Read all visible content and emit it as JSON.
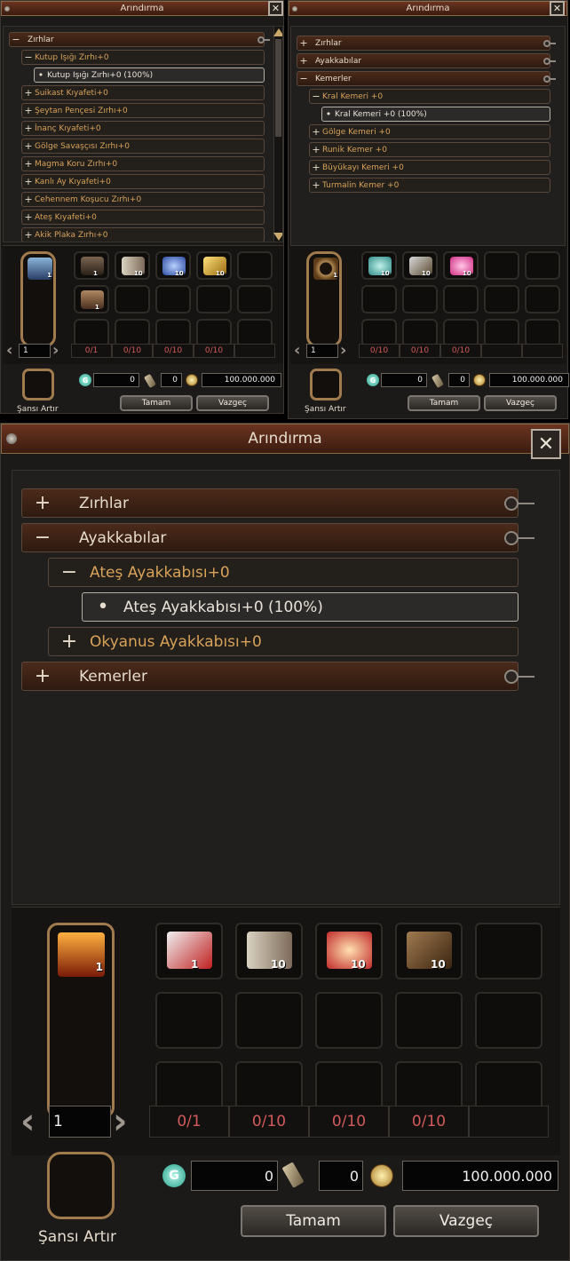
{
  "title": "Arındırma",
  "close_icon": "close-x-icon",
  "panels": {
    "top_left": {
      "tree": [
        {
          "kind": "cat",
          "sign": "−",
          "label": "Zırhlar"
        },
        {
          "kind": "sub",
          "sign": "−",
          "label": "Kutup Işığı Zırhı+0"
        },
        {
          "kind": "leaf",
          "sign": "•",
          "label": "Kutup Işığı Zırhı+0 (100%)"
        },
        {
          "kind": "sub",
          "sign": "+",
          "label": "Suikast Kıyafeti+0"
        },
        {
          "kind": "sub",
          "sign": "+",
          "label": "Şeytan Pençesi Zırhı+0"
        },
        {
          "kind": "sub",
          "sign": "+",
          "label": "İnanç Kıyafeti+0"
        },
        {
          "kind": "sub",
          "sign": "+",
          "label": "Gölge Savaşçısı Zırhı+0"
        },
        {
          "kind": "sub",
          "sign": "+",
          "label": "Magma Koru Zırhı+0"
        },
        {
          "kind": "sub",
          "sign": "+",
          "label": "Kanlı Ay Kıyafeti+0"
        },
        {
          "kind": "sub",
          "sign": "+",
          "label": "Cehennem Koşucu Zırhı+0"
        },
        {
          "kind": "sub",
          "sign": "+",
          "label": "Ateş Kıyafeti+0"
        },
        {
          "kind": "sub",
          "sign": "+",
          "label": "Akik Plaka Zırhı+0"
        }
      ],
      "main_item": {
        "icon": "blue-armor-icon",
        "qty": "1"
      },
      "materials": [
        {
          "icon": "dark-armor-icon",
          "qty": "1"
        },
        {
          "icon": "book-icon",
          "qty": "10"
        },
        {
          "icon": "blue-potion-icon",
          "qty": "10"
        },
        {
          "icon": "gold-bar-icon",
          "qty": "10"
        },
        {
          "icon": "",
          "qty": ""
        }
      ],
      "extra_item": {
        "icon": "helmet-icon",
        "qty": "1"
      },
      "counts": [
        "0/1",
        "0/10",
        "0/10",
        "0/10",
        ""
      ],
      "page": "1",
      "gem_value": "0",
      "scroll_value": "0",
      "cost": "100.000.000",
      "ok_label": "Tamam",
      "cancel_label": "Vazgeç",
      "chance_label": "Şansı Artır"
    },
    "top_right": {
      "tree": [
        {
          "kind": "cat",
          "sign": "+",
          "label": "Zırhlar"
        },
        {
          "kind": "cat",
          "sign": "+",
          "label": "Ayakkabılar"
        },
        {
          "kind": "cat",
          "sign": "−",
          "label": "Kemerler"
        },
        {
          "kind": "sub",
          "sign": "−",
          "label": "Kral Kemeri +0"
        },
        {
          "kind": "leaf",
          "sign": "•",
          "label": "Kral Kemeri +0 (100%)"
        },
        {
          "kind": "sub",
          "sign": "+",
          "label": "Gölge Kemeri +0"
        },
        {
          "kind": "sub",
          "sign": "+",
          "label": "Runik Kemer +0"
        },
        {
          "kind": "sub",
          "sign": "+",
          "label": "Büyükayı Kemeri +0"
        },
        {
          "kind": "sub",
          "sign": "+",
          "label": "Turmalin Kemer +0"
        }
      ],
      "main_item": {
        "icon": "belt-icon",
        "qty": "1"
      },
      "materials": [
        {
          "icon": "teal-rune-icon",
          "qty": "10"
        },
        {
          "icon": "gauntlet-icon",
          "qty": "10"
        },
        {
          "icon": "pink-gem-icon",
          "qty": "10"
        },
        {
          "icon": "",
          "qty": ""
        },
        {
          "icon": "",
          "qty": ""
        }
      ],
      "counts": [
        "0/10",
        "0/10",
        "0/10",
        "",
        ""
      ],
      "page": "1",
      "gem_value": "0",
      "scroll_value": "0",
      "cost": "100.000.000",
      "ok_label": "Tamam",
      "cancel_label": "Vazgeç",
      "chance_label": "Şansı Artır"
    },
    "bottom": {
      "tree": [
        {
          "kind": "cat",
          "sign": "+",
          "label": "Zırhlar"
        },
        {
          "kind": "cat",
          "sign": "−",
          "label": "Ayakkabılar"
        },
        {
          "kind": "sub",
          "sign": "−",
          "label": "Ateş Ayakkabısı+0"
        },
        {
          "kind": "leaf",
          "sign": "•",
          "label": "Ateş Ayakkabısı+0 (100%)"
        },
        {
          "kind": "sub",
          "sign": "+",
          "label": "Okyanus Ayakkabısı+0"
        },
        {
          "kind": "cat",
          "sign": "+",
          "label": "Kemerler"
        }
      ],
      "main_item": {
        "icon": "fire-boots-icon",
        "qty": "1"
      },
      "materials": [
        {
          "icon": "red-boots-icon",
          "qty": "1"
        },
        {
          "icon": "book-icon",
          "qty": "10"
        },
        {
          "icon": "red-potion-icon",
          "qty": "10"
        },
        {
          "icon": "whip-icon",
          "qty": "10"
        },
        {
          "icon": "",
          "qty": ""
        }
      ],
      "counts": [
        "0/1",
        "0/10",
        "0/10",
        "0/10",
        ""
      ],
      "page": "1",
      "gem_value": "0",
      "scroll_value": "0",
      "cost": "100.000.000",
      "ok_label": "Tamam",
      "cancel_label": "Vazgeç",
      "chance_label": "Şansı Artır"
    }
  },
  "colors": {
    "title_bar": "#5a2a18",
    "sub_label": "#d8a259",
    "count_text": "#d35a5a",
    "slot_frame": "#a17b4d"
  }
}
